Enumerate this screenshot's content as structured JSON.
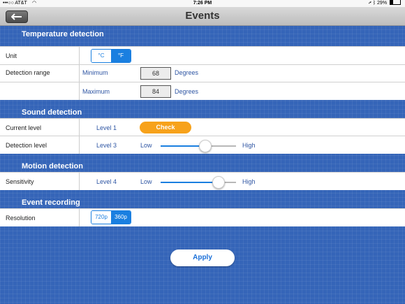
{
  "status_bar": {
    "carrier": "•••○○ AT&T",
    "time": "7:26 PM",
    "battery": "29%",
    "battery_level": 0.29
  },
  "nav": {
    "title": "Events"
  },
  "temperature": {
    "title": "Temperature detection",
    "unit_label": "Unit",
    "unit_options": [
      "°C",
      "°F"
    ],
    "unit_selected": "°F",
    "range_label": "Detection range",
    "min_label": "Minimum",
    "min_value": "68",
    "min_unit": "Degrees",
    "max_label": "Maximum",
    "max_value": "84",
    "max_unit": "Degrees"
  },
  "sound": {
    "title": "Sound detection",
    "current_label": "Current level",
    "current_value": "Level 1",
    "check_label": "Check",
    "detect_label": "Detection level",
    "detect_value": "Level 3",
    "low": "Low",
    "high": "High",
    "slider_fraction": 0.58
  },
  "motion": {
    "title": "Motion detection",
    "sensitivity_label": "Sensitivity",
    "sensitivity_value": "Level 4",
    "low": "Low",
    "high": "High",
    "slider_fraction": 0.76
  },
  "recording": {
    "title": "Event recording",
    "resolution_label": "Resolution",
    "options": [
      "720p",
      "360p"
    ],
    "selected": "360p"
  },
  "apply_label": "Apply",
  "colors": {
    "background": "#3565b8",
    "accent": "#1a7fe0",
    "check": "#f7a21b"
  },
  "icons": {
    "back": "back-arrow-icon",
    "wifi": "wifi-icon",
    "location": "location-icon",
    "bluetooth": "bluetooth-icon"
  }
}
